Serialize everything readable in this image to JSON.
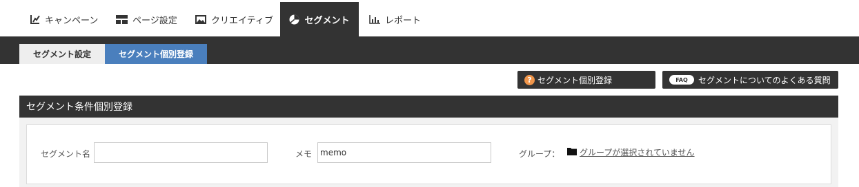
{
  "top_nav": {
    "tabs": [
      {
        "label": "キャンペーン",
        "icon": "edit-chart-icon"
      },
      {
        "label": "ページ設定",
        "icon": "layout-icon"
      },
      {
        "label": "クリエイティブ",
        "icon": "image-icon"
      },
      {
        "label": "セグメント",
        "icon": "pie-chart-icon",
        "active": true
      },
      {
        "label": "レポート",
        "icon": "bar-chart-icon"
      }
    ]
  },
  "sub_nav": {
    "tabs": [
      {
        "label": "セグメント設定",
        "active": false
      },
      {
        "label": "セグメント個別登録",
        "active": true
      }
    ]
  },
  "help": {
    "individual_label": "セグメント個別登録",
    "question_mark": "?",
    "faq_badge": "FAQ",
    "faq_label": "セグメントについてのよくある質問"
  },
  "section": {
    "title": "セグメント条件個別登録"
  },
  "form": {
    "segment_name_label": "セグメント名",
    "segment_name_value": "",
    "memo_label": "メモ",
    "memo_value": "memo",
    "group_label": "グループ：",
    "group_link_text": "グループが選択されていません"
  },
  "colors": {
    "dark": "#333333",
    "accent_blue": "#4a7fbd",
    "help_orange": "#f0954a",
    "panel_bg": "#f2f2f2"
  }
}
